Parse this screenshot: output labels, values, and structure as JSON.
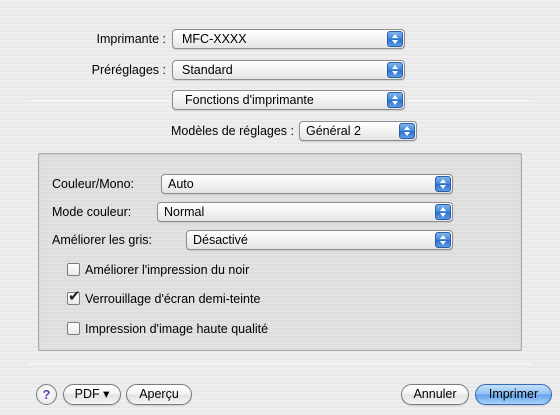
{
  "printer": {
    "label": "Imprimante :",
    "value": "MFC-XXXX"
  },
  "presets": {
    "label": "Préréglages :",
    "value": "Standard"
  },
  "section": {
    "value": "Fonctions d'imprimante"
  },
  "model": {
    "label": "Modèles de réglages :",
    "value": "Général 2"
  },
  "settings": {
    "color_mono": {
      "label": "Couleur/Mono:",
      "value": "Auto"
    },
    "color_mode": {
      "label": "Mode couleur:",
      "value": "Normal"
    },
    "gray": {
      "label": "Améliorer les gris:",
      "value": "Désactivé"
    }
  },
  "checkboxes": [
    {
      "label": "Améliorer l'impression du noir",
      "checked": false
    },
    {
      "label": "Verrouillage d'écran demi-teinte",
      "checked": true
    },
    {
      "label": "Impression d'image haute qualité",
      "checked": false
    }
  ],
  "footer": {
    "help": "?",
    "pdf": "PDF ▾",
    "preview": "Aperçu",
    "cancel": "Annuler",
    "print": "Imprimer"
  },
  "check_glyph": "✔"
}
